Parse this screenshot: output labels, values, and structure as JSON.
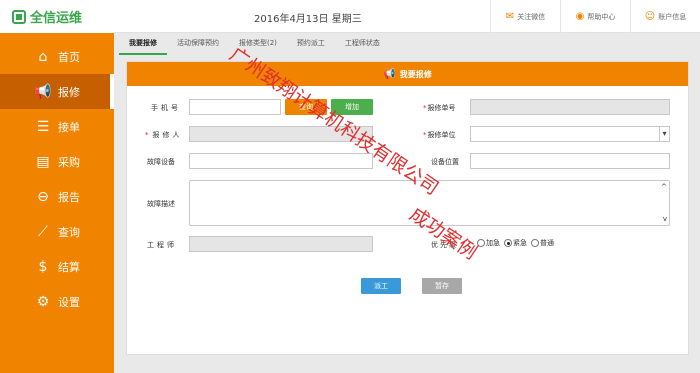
{
  "app": {
    "logo_text": "全信运维",
    "date": "2016年4月13日 星期三"
  },
  "top_actions": [
    {
      "icon": "wechat-icon",
      "label": "关注微信"
    },
    {
      "icon": "eye-icon",
      "label": "帮助中心"
    },
    {
      "icon": "user-icon",
      "label": "账户信息"
    }
  ],
  "sidebar": {
    "items": [
      {
        "icon": "home-icon",
        "label": "首页"
      },
      {
        "icon": "megaphone-icon",
        "label": "报修"
      },
      {
        "icon": "list-icon",
        "label": "接单"
      },
      {
        "icon": "cart-icon",
        "label": "采购"
      },
      {
        "icon": "report-icon",
        "label": "报告"
      },
      {
        "icon": "chart-icon",
        "label": "查询"
      },
      {
        "icon": "dollar-icon",
        "label": "结算"
      },
      {
        "icon": "gear-icon",
        "label": "设置"
      }
    ]
  },
  "tabs": [
    "我要报修",
    "活动保障预约",
    "报修类型(2)",
    "预约派工",
    "工程师状态"
  ],
  "panel": {
    "title": "我要报修"
  },
  "form": {
    "phone_label": "手机号",
    "query_button": "查询",
    "add_button": "增加",
    "repair_no_label": "报修单号",
    "reporter_label": "报修人",
    "unit_label": "报修单位",
    "device_label": "故障设备",
    "location_label": "设备位置",
    "description_label": "故障描述",
    "engineer_label": "工程师",
    "priority_label": "优先级",
    "priority_options": [
      "加急",
      "紧急",
      "普通"
    ],
    "priority_selected": "紧急",
    "dispatch_button": "派工",
    "hold_button": "暂存"
  },
  "watermark": {
    "line1": "广州致翔计算机科技有限公司",
    "line2": "成功案例"
  }
}
